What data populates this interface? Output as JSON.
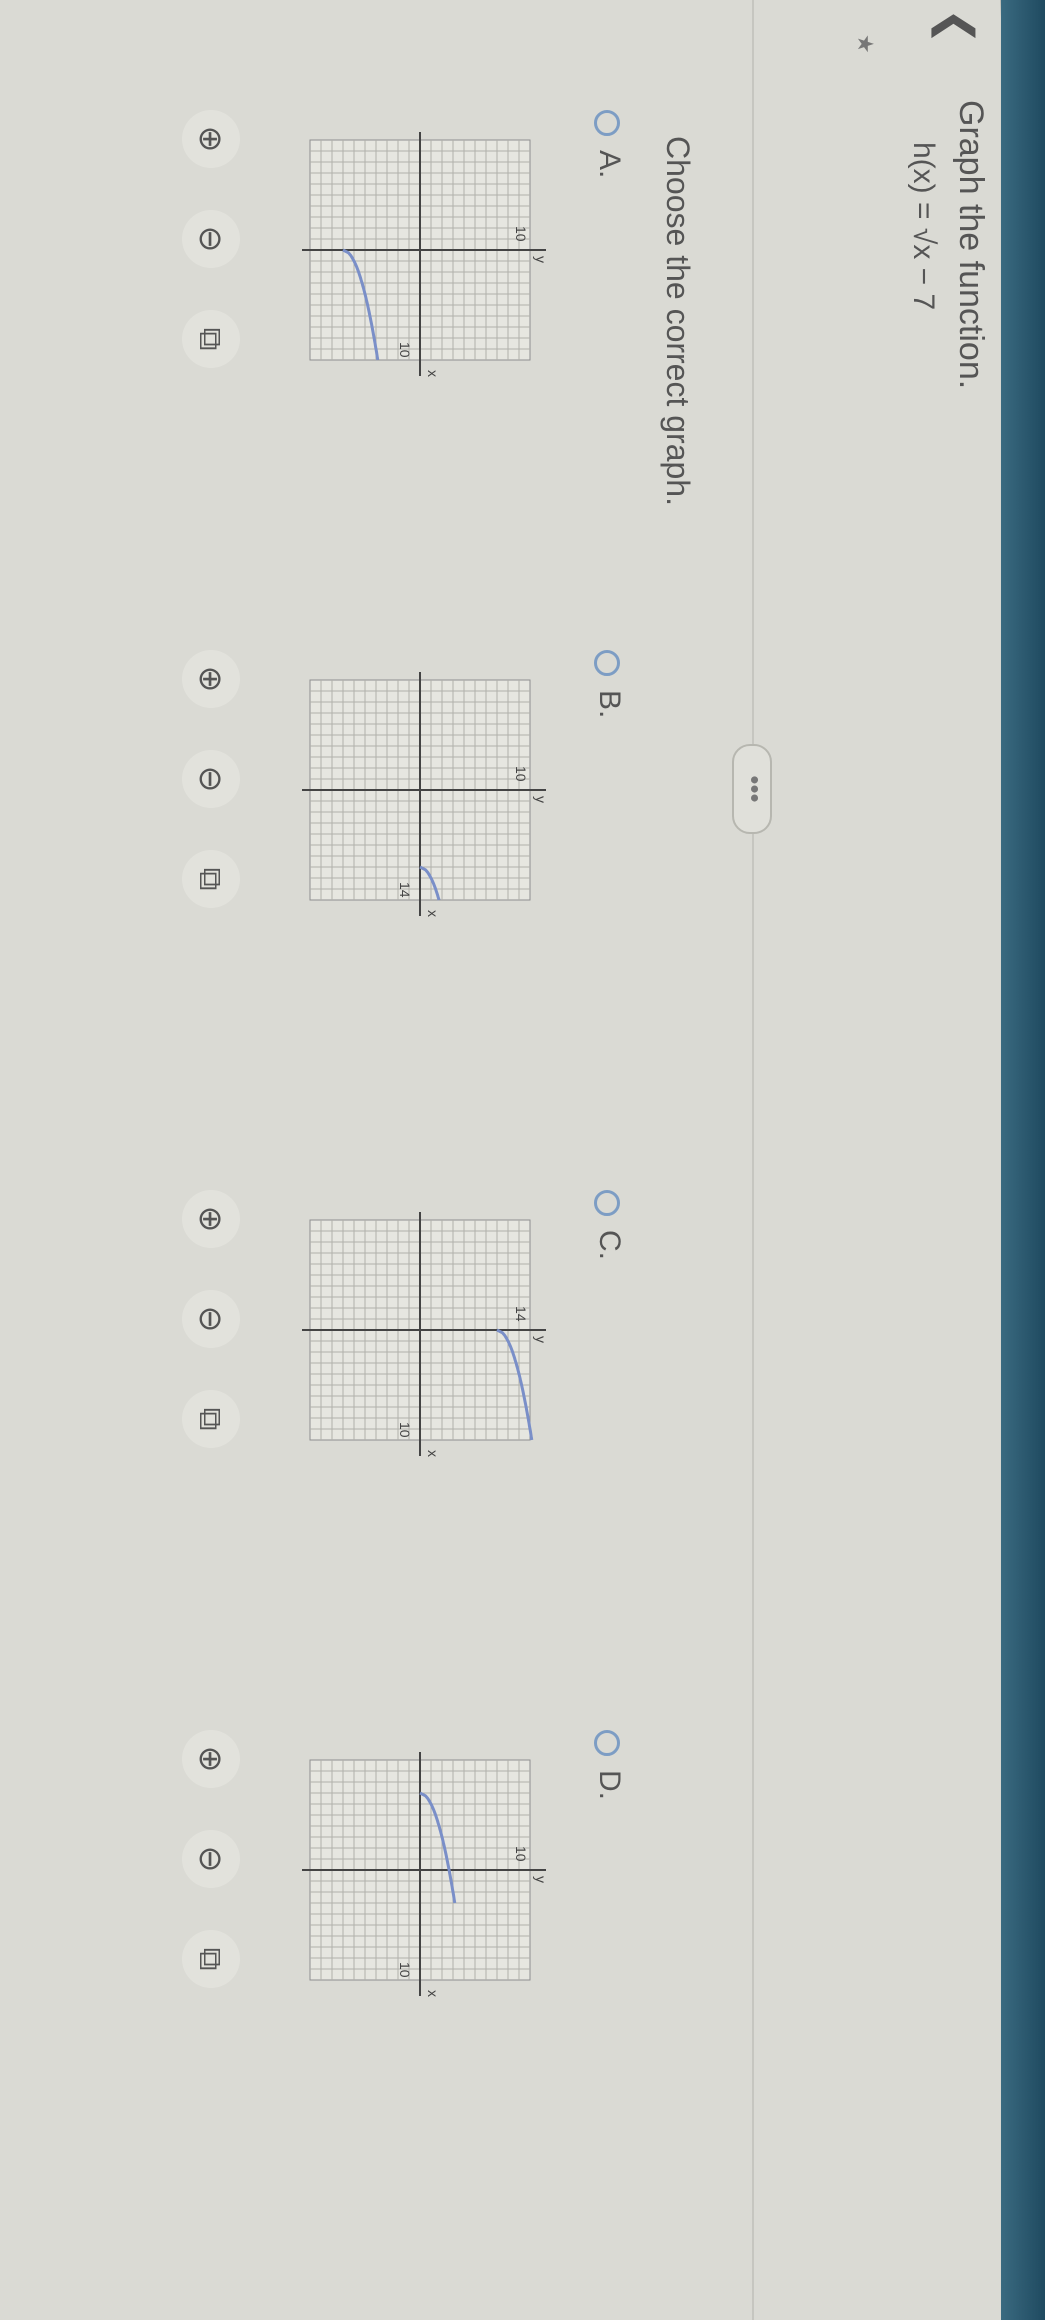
{
  "question": {
    "title": "Graph the function.",
    "function": "h(x) = √x − 7"
  },
  "more_button": "•••",
  "prompt": "Choose the correct graph.",
  "options": [
    {
      "label": "A.",
      "curve_start": [
        0,
        -7
      ],
      "x_tick": "10",
      "y_tick": "10"
    },
    {
      "label": "B.",
      "curve_start": [
        7,
        0
      ],
      "x_tick": "14",
      "y_tick": "10"
    },
    {
      "label": "C.",
      "curve_start": [
        0,
        7
      ],
      "x_tick": "10",
      "y_tick": "14"
    },
    {
      "label": "D.",
      "curve_start": [
        -7,
        0
      ],
      "x_tick": "10",
      "y_tick": "10"
    }
  ],
  "icons": {
    "back": "back-arrow-icon",
    "zoom_in": "zoom-in-icon",
    "zoom_out": "zoom-out-icon",
    "popout": "popout-icon"
  },
  "colors": {
    "curve": "#7a8fc8",
    "radio": "#7d9dc4",
    "grid": "#8f8f8f"
  }
}
